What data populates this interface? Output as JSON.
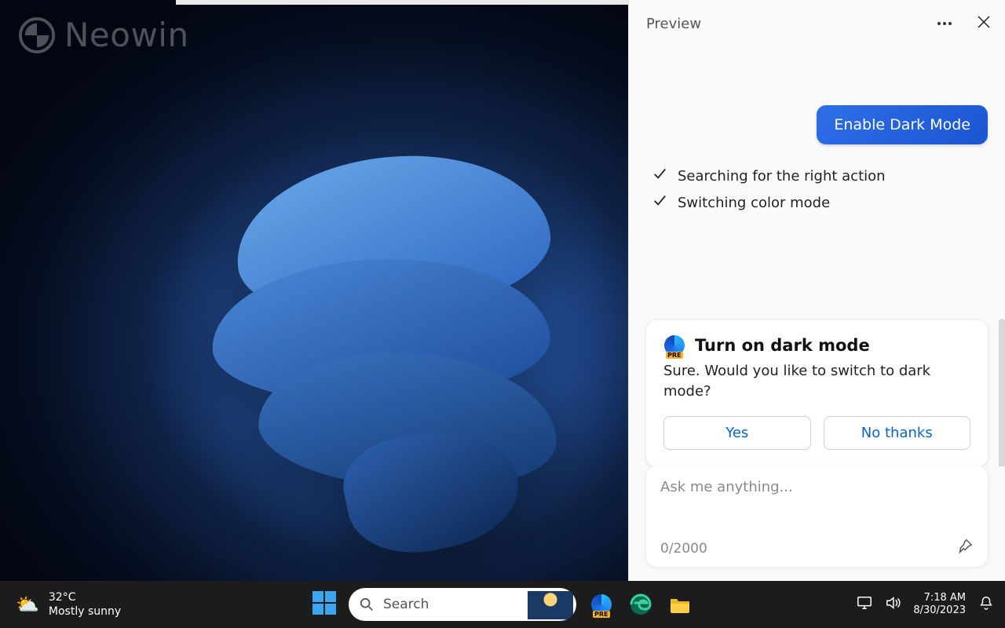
{
  "watermark": {
    "text": "Neowin"
  },
  "panel": {
    "title": "Preview",
    "user_pill": "Enable Dark Mode",
    "progress": [
      "Searching for the right action",
      "Switching color mode"
    ],
    "card": {
      "title": "Turn on dark mode",
      "body": "Sure. Would you like to switch to dark mode?",
      "yes": "Yes",
      "no": "No thanks",
      "badge": "PRE"
    },
    "input": {
      "placeholder": "Ask me anything...",
      "counter": "0/2000"
    }
  },
  "taskbar": {
    "weather_temp": "32°C",
    "weather_desc": "Mostly sunny",
    "search_placeholder": "Search",
    "time": "7:18 AM",
    "date": "8/30/2023"
  }
}
